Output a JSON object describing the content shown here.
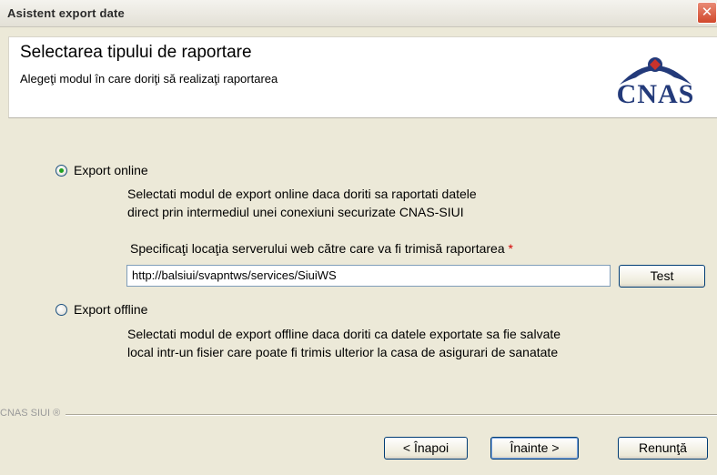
{
  "window": {
    "title": "Asistent export date",
    "close_glyph": "✕"
  },
  "header": {
    "title": "Selectarea tipului de raportare",
    "subtitle": "Alegeţi modul în care doriţi să realizaţi raportarea",
    "logo_text": "CNAS"
  },
  "options": {
    "online": {
      "label": "Export online",
      "selected": true,
      "desc_line1": "Selectati modul de export online daca doriti sa raportati datele",
      "desc_line2": "direct prin intermediul unei conexiuni securizate CNAS-SIUI",
      "server_label": "Specificaţi locaţia serverului web către care va fi trimisă raportarea",
      "required_mark": "*",
      "server_url": "http://balsiui/svapntws/services/SiuiWS",
      "test_label": "Test"
    },
    "offline": {
      "label": "Export offline",
      "selected": false,
      "desc_line1": "Selectati modul de export offline daca doriti ca datele exportate sa fie salvate",
      "desc_line2": "local intr-un fisier care poate fi trimis ulterior la casa de asigurari de sanatate"
    }
  },
  "footer": {
    "brand": "CNAS SIUI ®",
    "back_label": "< Înapoi",
    "next_label": "Înainte >",
    "cancel_label": "Renunţă"
  },
  "colors": {
    "logo_blue": "#233a7a",
    "logo_red": "#c8332b",
    "window_bg": "#ece9d8",
    "required": "#d40000"
  }
}
